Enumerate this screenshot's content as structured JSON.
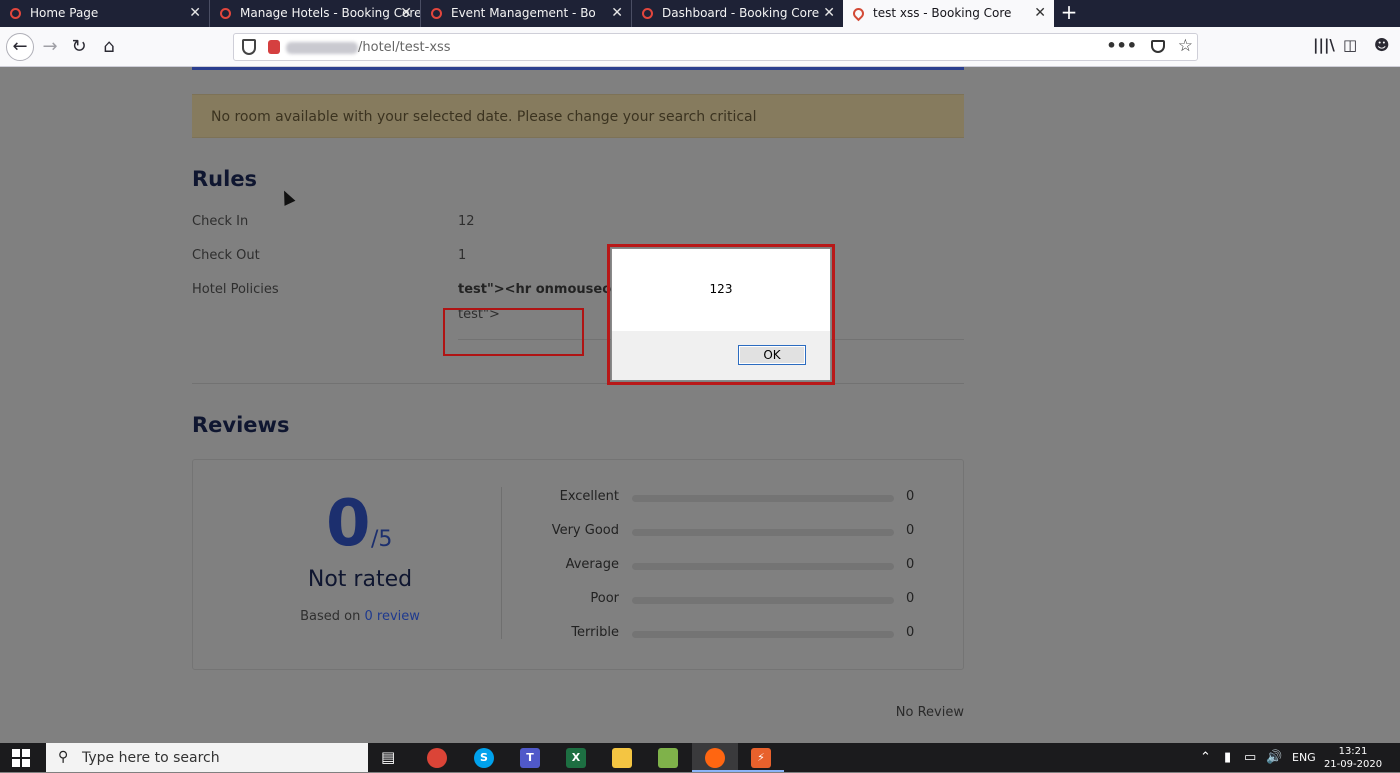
{
  "browser": {
    "tabs": [
      {
        "label": "Home Page",
        "close": "✕"
      },
      {
        "label": "Manage Hotels - Booking Core",
        "close": "✕"
      },
      {
        "label": "Event Management - Booking Core",
        "close": "✕"
      },
      {
        "label": "Dashboard - Booking Core",
        "close": "✕"
      },
      {
        "label": "test xss - Booking Core",
        "close": "✕"
      }
    ],
    "new_tab": "+",
    "url_path": "/hotel/test-xss",
    "page_actions": "•••"
  },
  "page": {
    "alert_text": "No room available with your selected date. Please change your search critical",
    "rules": {
      "heading": "Rules",
      "rows": [
        {
          "label": "Check In",
          "value": "12"
        },
        {
          "label": "Check Out",
          "value": "1"
        },
        {
          "label": "Hotel Policies",
          "value": "test\"><hr onmouseov",
          "extra": "test\">"
        }
      ]
    },
    "reviews": {
      "heading": "Reviews",
      "score": "0",
      "score_max": "/5",
      "rating_text": "Not rated",
      "based_prefix": "Based on",
      "based_link": "0 review",
      "breakdown": [
        {
          "label": "Excellent",
          "count": "0",
          "fraction": 0
        },
        {
          "label": "Very Good",
          "count": "0",
          "fraction": 0
        },
        {
          "label": "Average",
          "count": "0",
          "fraction": 0
        },
        {
          "label": "Poor",
          "count": "0",
          "fraction": 0
        },
        {
          "label": "Terrible",
          "count": "0",
          "fraction": 0
        }
      ],
      "no_review": "No Review"
    }
  },
  "dialog": {
    "message": "123",
    "ok_label": "OK"
  },
  "taskbar": {
    "search_placeholder": "Type here to search",
    "language": "ENG",
    "time": "13:21",
    "date": "21-09-2020"
  }
}
